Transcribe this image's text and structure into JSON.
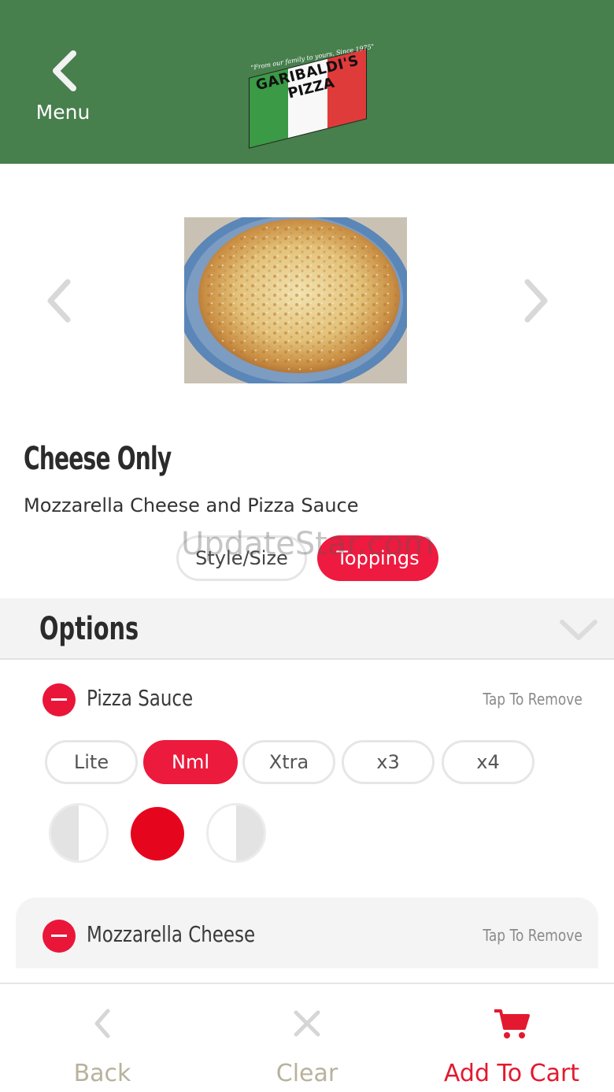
{
  "header": {
    "back_label": "Menu",
    "logo": {
      "tagline": "\"From our family to yours, Since 1975\"",
      "line1": "GARIBALDI'S",
      "line2": "PIZZA"
    }
  },
  "item": {
    "title": "Cheese Only",
    "description": "Mozzarella Cheese and Pizza Sauce",
    "image_alt": "Cheese pizza"
  },
  "tabs": [
    {
      "label": "Style/Size",
      "active": false
    },
    {
      "label": "Toppings",
      "active": true
    }
  ],
  "watermark": "UpdateStar.com",
  "options": {
    "title": "Options",
    "toppings": [
      {
        "name": "Pizza Sauce",
        "action": "Tap To Remove",
        "amounts": [
          "Lite",
          "Nml",
          "Xtra",
          "x3",
          "x4"
        ],
        "selected_amount": "Nml",
        "portions": [
          "left-half",
          "whole",
          "right-half"
        ],
        "selected_portion": "whole"
      },
      {
        "name": "Mozzarella Cheese",
        "action": "Tap To Remove"
      }
    ]
  },
  "bottom_bar": {
    "back": "Back",
    "clear": "Clear",
    "add_to_cart": "Add To Cart"
  },
  "colors": {
    "header_green": "#477f4d",
    "accent_red": "#ec1a3c",
    "muted_label": "#b8b29c"
  },
  "icons": {
    "back": "chevron-left-icon",
    "prev": "chevron-left-icon",
    "next": "chevron-right-icon",
    "collapse": "chevron-down-icon",
    "clear": "close-icon",
    "cart": "cart-icon"
  }
}
